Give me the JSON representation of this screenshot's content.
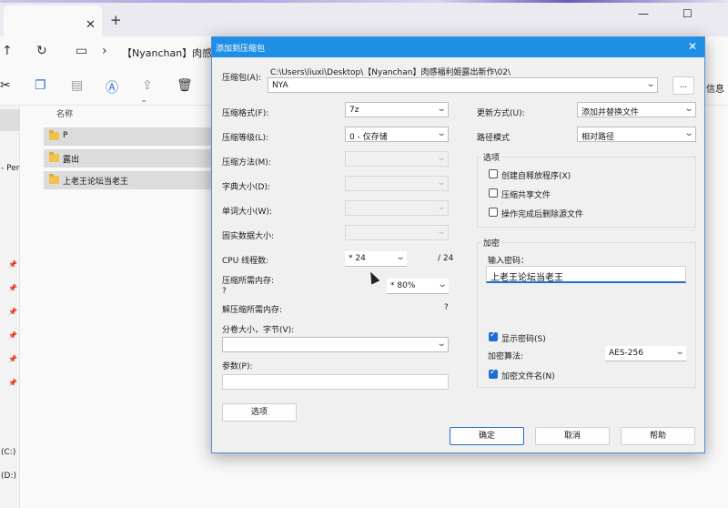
{
  "explorer": {
    "tab_close": "✕",
    "tab_plus": "+",
    "window_controls": [
      "—",
      "☐"
    ],
    "nav_icons": [
      "up-arrow-icon",
      "refresh-icon",
      "monitor-icon",
      "chevron-right-icon"
    ],
    "address": "【Nyanchan】肉感福",
    "toolbar_info": "信息",
    "sidebar": {
      "partial_text": "- Per",
      "drives": [
        "(C:)",
        "(D:)"
      ]
    },
    "column_name": "名称",
    "files": [
      "P",
      "露出",
      "上老王论坛当老王"
    ]
  },
  "dialog": {
    "title": "添加到压缩包",
    "close": "✕",
    "archive_label": "压缩包(A):",
    "archive_path": "C:\\Users\\liuxi\\Desktop\\【Nyanchan】肉感福利姬露出新作\\02\\",
    "archive_name": "NYA",
    "browse": "...",
    "left": {
      "format_label": "压缩格式(F):",
      "format_value": "7z",
      "level_label": "压缩等级(L):",
      "level_value": "0 - 仅存储",
      "method_label": "压缩方法(M):",
      "dict_label": "字典大小(D):",
      "word_label": "单词大小(W):",
      "solid_label": "固实数据大小:",
      "cpu_label": "CPU 线程数:",
      "cpu_value": "* 24",
      "cpu_total": "/ 24",
      "mem_label": "压缩所需内存:",
      "mem_q": "?",
      "mem_value": "* 80%",
      "decomp_label": "解压缩所需内存:",
      "decomp_q": "?",
      "split_label": "分卷大小，字节(V):",
      "params_label": "参数(P):",
      "options_button": "选项"
    },
    "right": {
      "update_label": "更新方式(U):",
      "update_value": "添加并替换文件",
      "path_label": "路径模式",
      "path_value": "相对路径",
      "options_title": "选项",
      "opt_sfx": "创建自释放程序(X)",
      "opt_shared": "压缩共享文件",
      "opt_delete": "操作完成后删除源文件",
      "encrypt_title": "加密",
      "pw_label": "输入密码：",
      "pw_value": "上老王论坛当老王",
      "show_pw": "显示密码(S)",
      "algo_label": "加密算法:",
      "algo_value": "AES-256",
      "encrypt_names": "加密文件名(N)"
    },
    "buttons": {
      "ok": "确定",
      "cancel": "取消",
      "help": "帮助"
    }
  }
}
